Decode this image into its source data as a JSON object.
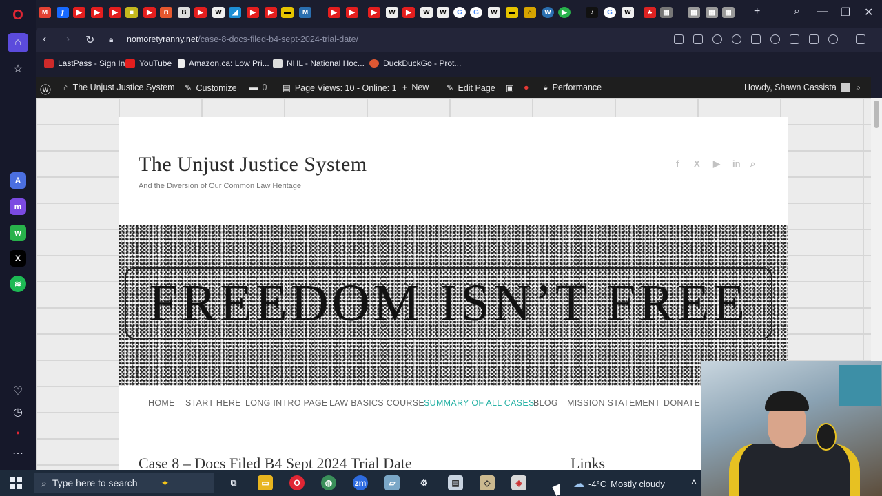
{
  "browser": {
    "url_domain": "nomoretyranny.net",
    "url_path": "/case-8-docs-filed-b4-sept-2024-trial-date/",
    "bookmarks": [
      "LastPass - Sign In",
      "YouTube",
      "Amazon.ca: Low Pri...",
      "NHL - National Hoc...",
      "DuckDuckGo - Prot..."
    ]
  },
  "wp_admin_bar": {
    "site_name": "The Unjust Justice System",
    "customize": "Customize",
    "comments_count": "0",
    "page_views": "Page Views: 10 - Online: 1",
    "new": "New",
    "edit_page": "Edit Page",
    "performance": "Performance",
    "howdy": "Howdy, Shawn Cassista"
  },
  "site": {
    "title": "The Unjust Justice System",
    "tagline": "And the Diversion of Our Common Law Heritage",
    "banner_text": "FREEDOM ISN’T FREE",
    "social_icons": [
      "f",
      "X",
      "▶",
      "in",
      "⌕"
    ],
    "menu": [
      "HOME",
      "START HERE",
      "LONG INTRO PAGE",
      "LAW BASICS COURSE",
      "SUMMARY OF ALL CASES",
      "BLOG",
      "MISSION STATEMENT",
      "DONATE"
    ],
    "post_title": "Case 8 – Docs Filed B4 Sept 2024 Trial Date",
    "links_heading": "Links"
  },
  "taskbar": {
    "search_placeholder": "Type here to search",
    "temperature": "-4°C",
    "weather": "Mostly cloudy"
  },
  "colors": {
    "accent_menu": "#2ab3a6",
    "opera_red": "#e02634",
    "wp_bar": "#1e1e1e"
  }
}
